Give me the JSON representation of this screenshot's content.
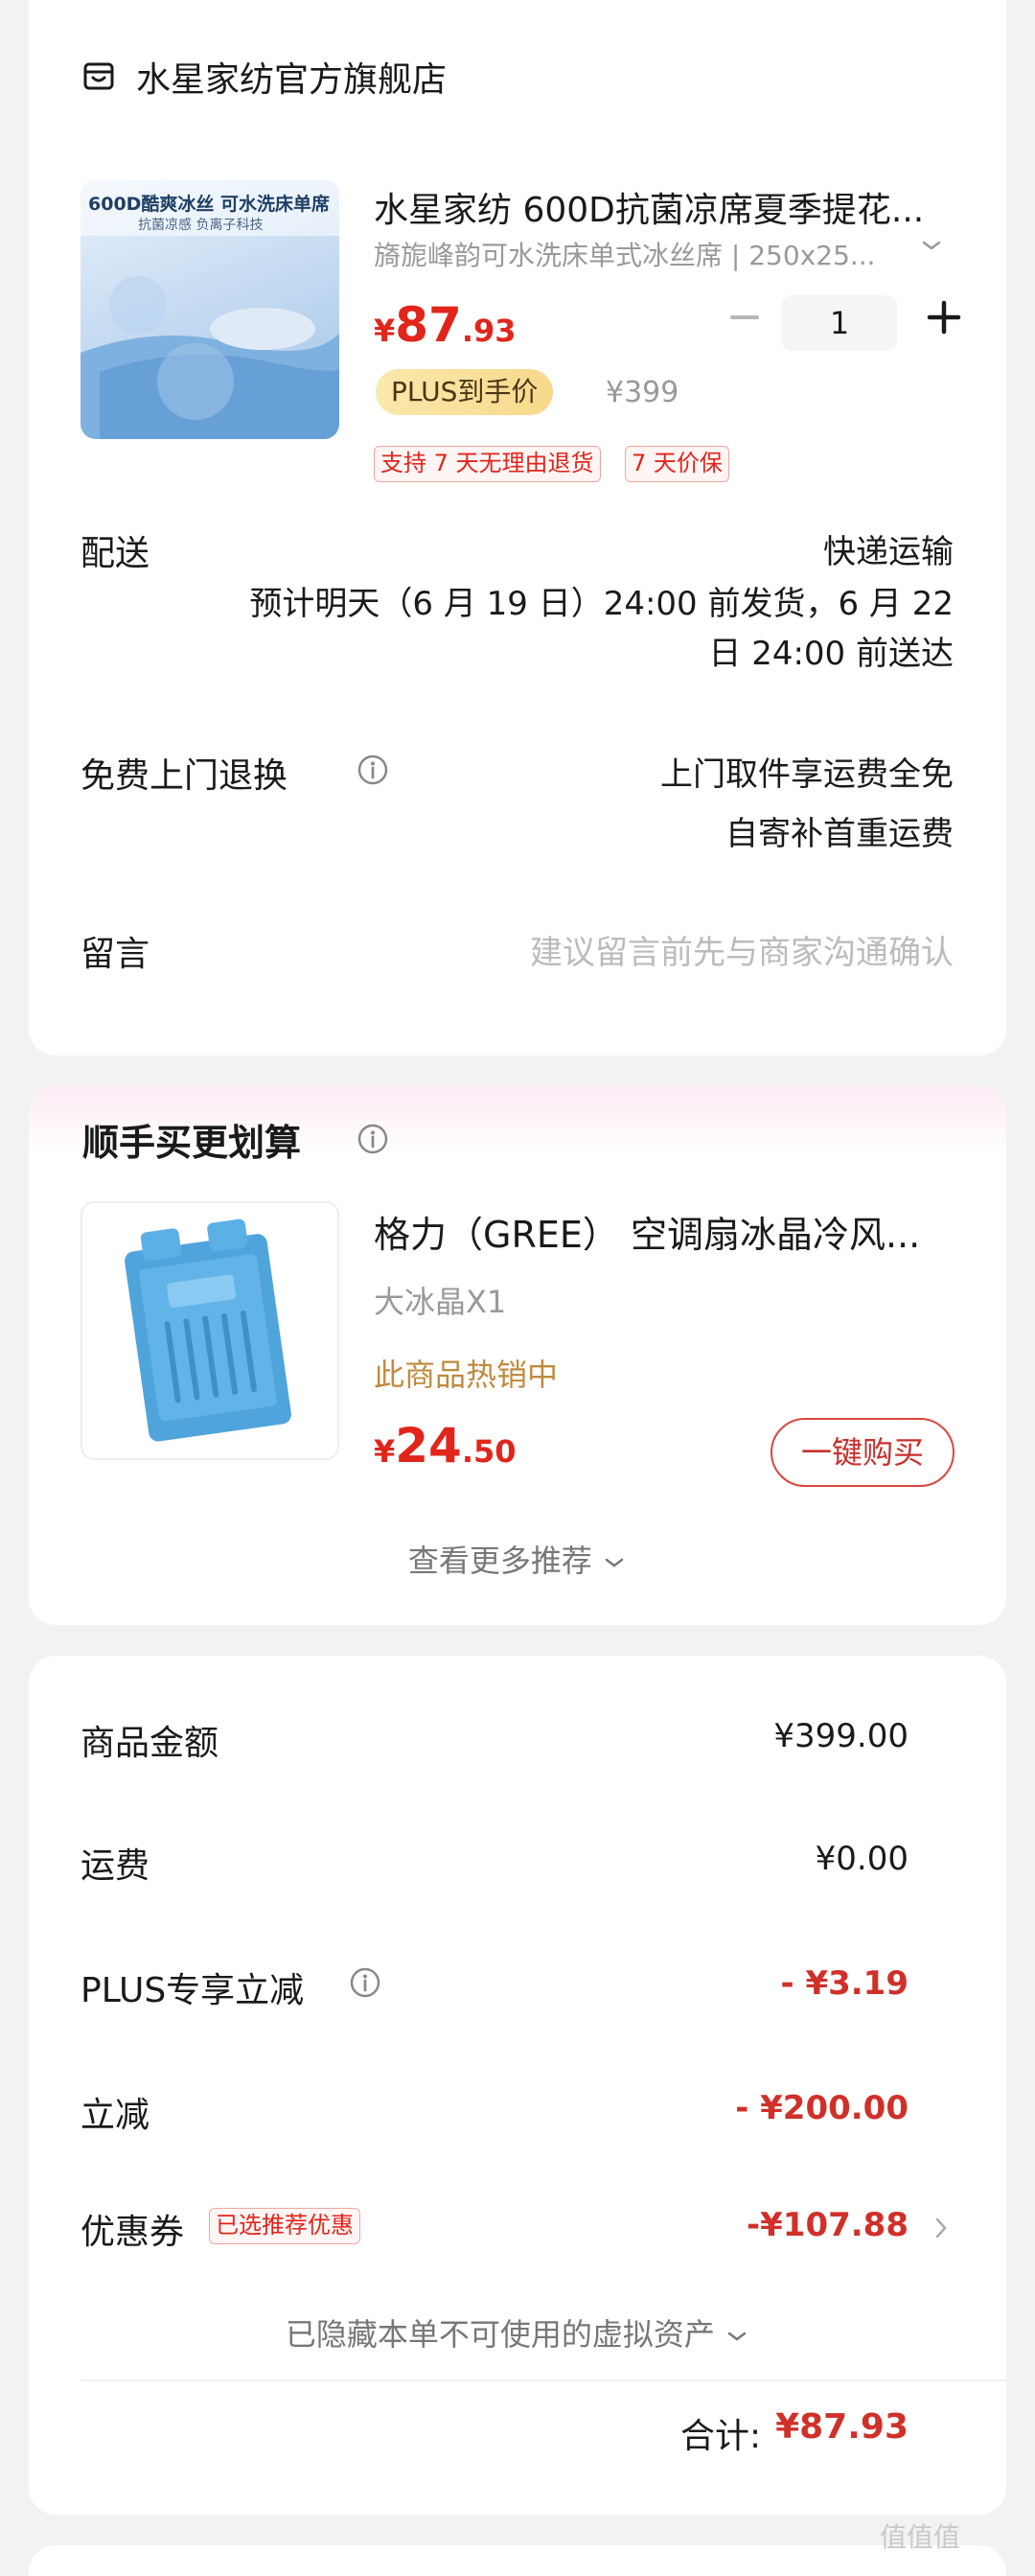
{
  "store": {
    "name": "水星家纺官方旗舰店"
  },
  "product": {
    "image_banner": "600D酷爽冰丝 可水洗床单席",
    "image_sub": "抗菌凉感 负离子科技",
    "title": "水星家纺 600D抗菌凉席夏季提花...",
    "sku": "旖旎峰韵可水洗床单式冰丝席 | 250x25...",
    "price_currency": "¥",
    "price_int": "87",
    "price_dec": ".93",
    "quantity": "1",
    "plus_badge": "PLUS到手价",
    "original_price": "¥399",
    "tags": [
      "支持 7 天无理由退货",
      "7 天价保"
    ]
  },
  "delivery": {
    "label": "配送",
    "method": "快递运输",
    "eta_line1": "预计明天（6 月 19 日）24:00 前发货，6 月 22",
    "eta_line2": "日 24:00 前送达"
  },
  "returns": {
    "label": "免费上门退换",
    "line1": "上门取件享运费全免",
    "line2": "自寄补首重运费"
  },
  "message": {
    "label": "留言",
    "placeholder": "建议留言前先与商家沟通确认"
  },
  "recommend": {
    "title": "顺手买更划算",
    "name": "格力（GREE） 空调扇冰晶冷风...",
    "sku": "大冰晶X1",
    "status": "此商品热销中",
    "price_currency": "¥",
    "price_int": "24",
    "price_dec": ".50",
    "buy_label": "一键购买",
    "more_label": "查看更多推荐"
  },
  "summary": {
    "items": [
      {
        "label": "商品金额",
        "value": "¥399.00"
      },
      {
        "label": "运费",
        "value": "¥0.00"
      },
      {
        "label": "PLUS专享立减",
        "value": "- ¥3.19"
      },
      {
        "label": "立减",
        "value": "- ¥200.00"
      },
      {
        "label": "优惠券",
        "value": "-¥107.88"
      }
    ],
    "coupon_tag": "已选推荐优惠",
    "hidden_assets": "已隐藏本单不可使用的虚拟资产",
    "total_label": "合计:",
    "total_value": "¥87.93"
  },
  "watermark": "值值值",
  "colors": {
    "price_red": "#e1251b",
    "plus_gold": "#f8d98b",
    "hot_text": "#c08a3e"
  },
  "icons": [
    "store-icon",
    "chevron-down-icon",
    "minus-icon",
    "plus-icon",
    "info-icon",
    "chevron-right-icon"
  ]
}
